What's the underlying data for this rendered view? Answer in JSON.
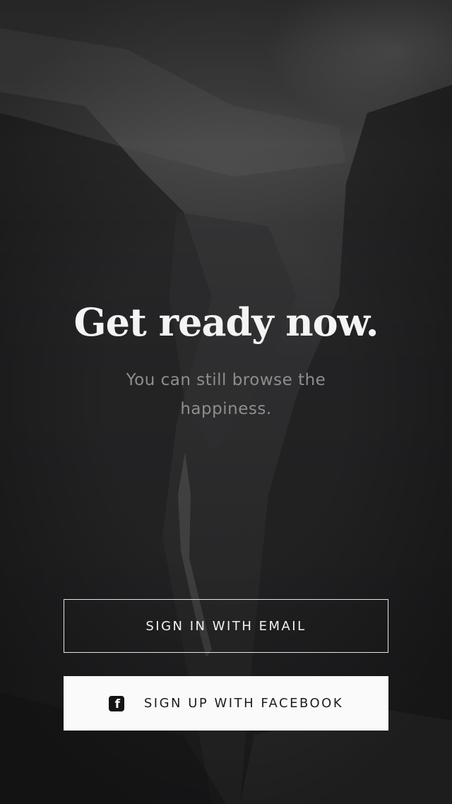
{
  "hero": {
    "title": "Get ready now.",
    "subtitle": "You can still browse the happiness."
  },
  "actions": {
    "email_label": "SIGN IN WITH EMAIL",
    "facebook_label": "SIGN UP WITH FACEBOOK",
    "facebook_icon": "facebook-icon",
    "facebook_icon_glyph": "f"
  },
  "colors": {
    "background": "#2a2a2b",
    "title": "#f4f4f4",
    "subtitle": "#8e8e8e",
    "button_border": "#e6e6e6",
    "button_fill": "#fafafa"
  }
}
